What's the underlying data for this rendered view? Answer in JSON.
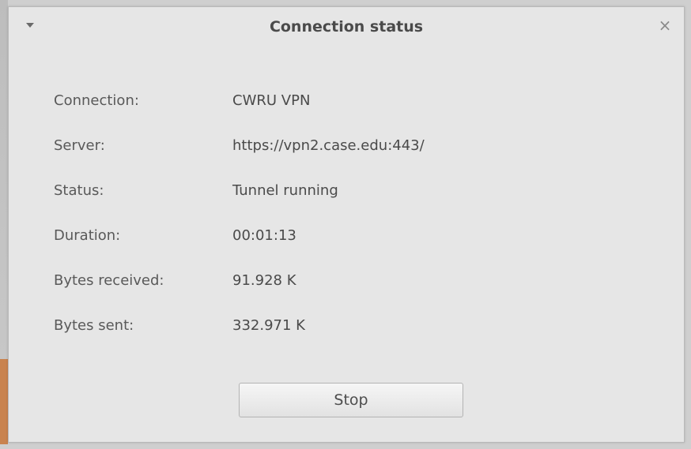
{
  "window": {
    "title": "Connection status",
    "close_glyph": "×",
    "menu_icon": "chevron-down-icon"
  },
  "info": [
    {
      "label": "Connection:",
      "value": "CWRU VPN"
    },
    {
      "label": "Server:",
      "value": "https://vpn2.case.edu:443/"
    },
    {
      "label": "Status:",
      "value": "Tunnel running"
    },
    {
      "label": "Duration:",
      "value": "00:01:13"
    },
    {
      "label": "Bytes received:",
      "value": "91.928 K"
    },
    {
      "label": "Bytes sent:",
      "value": "332.971 K"
    }
  ],
  "actions": {
    "stop_label": "Stop"
  },
  "colors": {
    "window_bg": "#e6e6e6",
    "title_text": "#4a4a4a",
    "label_text": "#595959"
  }
}
